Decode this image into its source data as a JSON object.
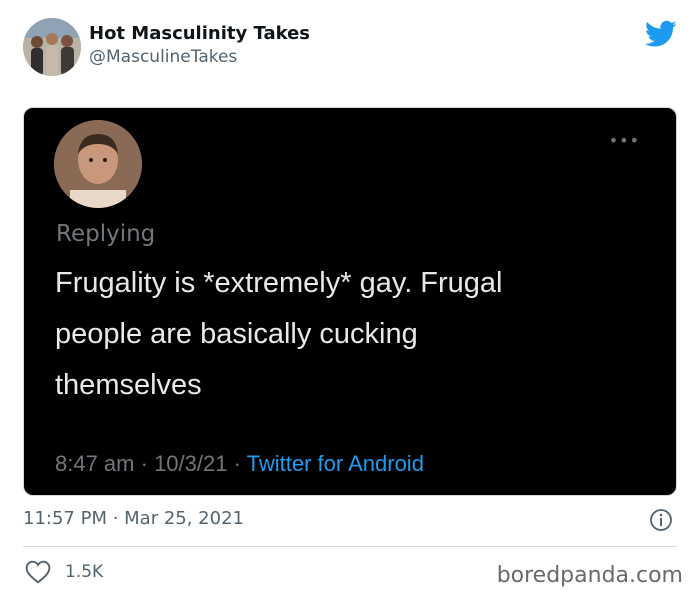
{
  "author": {
    "name": "Hot Masculinity Takes",
    "handle": "@MasculineTakes"
  },
  "embedded_tweet": {
    "replying_label": "Replying",
    "text_lines": [
      "Frugality is *extremely* gay. Frugal",
      "people are basically cucking",
      "themselves"
    ],
    "time": "8:47 am",
    "date": "10/3/21",
    "source": "Twitter for Android",
    "separator": " · ",
    "more_label": "•••"
  },
  "tweet_meta": {
    "time": "11:57 PM",
    "separator": " · ",
    "date": "Mar 25, 2021"
  },
  "actions": {
    "like_count": "1.5K"
  },
  "watermark": "boredpanda.com",
  "colors": {
    "twitter_blue": "#1d9bf0",
    "text_primary": "#0f1419",
    "text_secondary": "#536471",
    "dark_background": "#000000"
  },
  "icons": {
    "bird": "twitter-bird-icon",
    "info": "info-icon",
    "like": "heart-icon",
    "more": "more-dots-icon"
  }
}
